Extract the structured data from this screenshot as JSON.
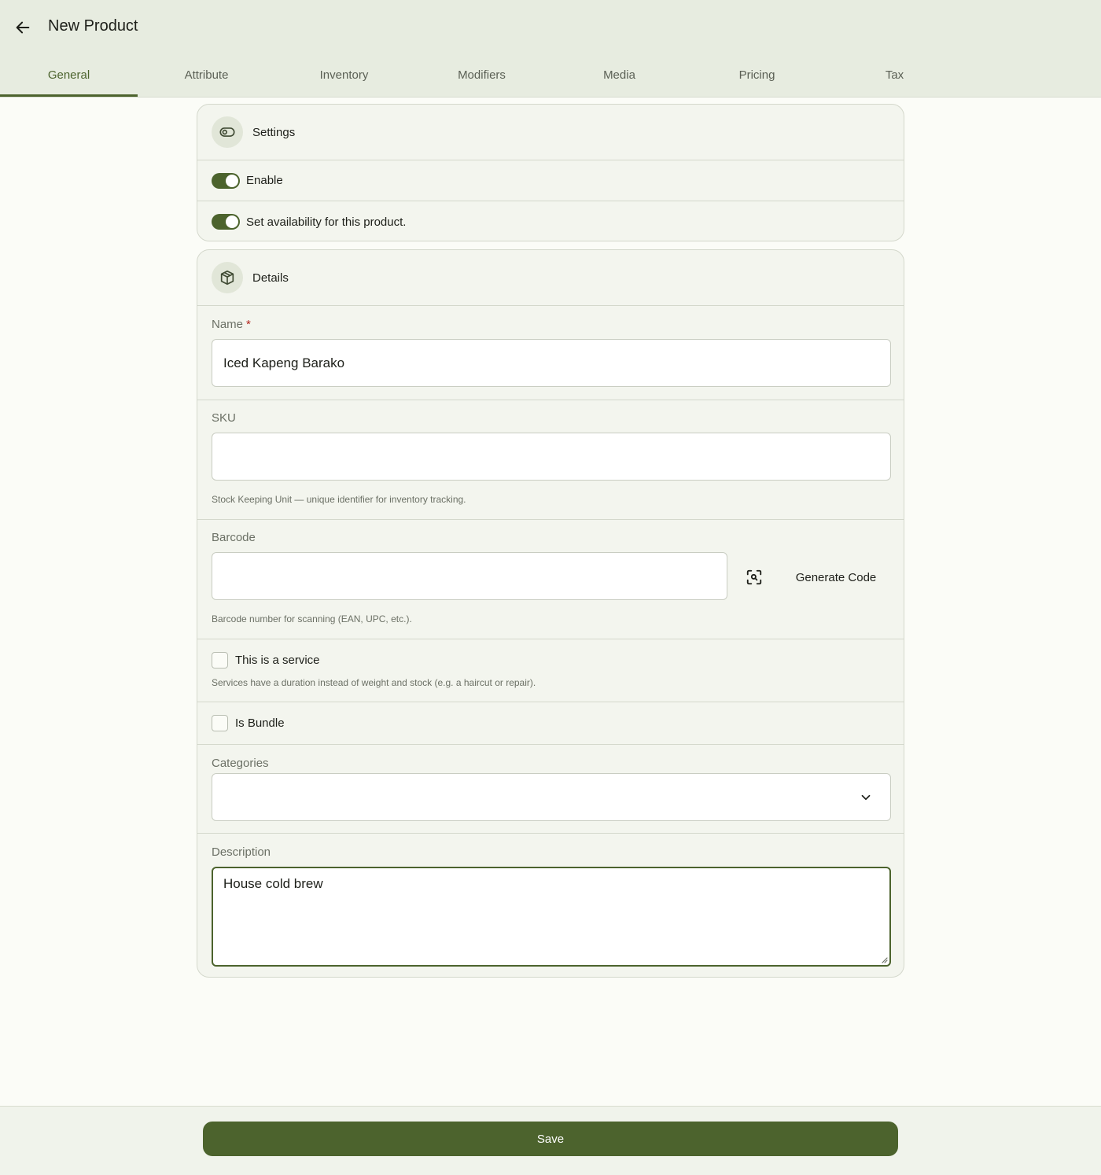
{
  "header": {
    "title": "New Product",
    "back_icon": "arrow-left-icon"
  },
  "tabs": [
    {
      "label": "General",
      "active": true
    },
    {
      "label": "Attribute",
      "active": false
    },
    {
      "label": "Inventory",
      "active": false
    },
    {
      "label": "Modifiers",
      "active": false
    },
    {
      "label": "Media",
      "active": false
    },
    {
      "label": "Pricing",
      "active": false
    },
    {
      "label": "Tax",
      "active": false
    }
  ],
  "settings": {
    "title": "Settings",
    "icon": "toggle-icon",
    "enable": {
      "label": "Enable",
      "on": true
    },
    "availability": {
      "label": "Set availability for this product.",
      "on": true
    }
  },
  "details": {
    "title": "Details",
    "icon": "box-icon",
    "name": {
      "label": "Name",
      "required_mark": "*",
      "value": "Iced Kapeng Barako"
    },
    "sku": {
      "label": "SKU",
      "value": "",
      "helper": "Stock Keeping Unit — unique identifier for inventory tracking."
    },
    "barcode": {
      "label": "Barcode",
      "value": "",
      "generate_label": "Generate Code",
      "helper": "Barcode number for scanning (EAN, UPC, etc.)."
    },
    "service": {
      "label": "This is a service",
      "checked": false,
      "helper": "Services have a duration instead of weight and stock (e.g. a haircut or repair)."
    },
    "bundle": {
      "label": "Is Bundle",
      "checked": false
    },
    "categories": {
      "label": "Categories",
      "value": ""
    },
    "description": {
      "label": "Description",
      "value": "House cold brew"
    }
  },
  "footer": {
    "save_label": "Save"
  },
  "colors": {
    "accent": "#4c632d",
    "header_bg": "#e7ece0",
    "page_bg": "#fbfcf7",
    "card_bg": "#f3f5ee",
    "required": "#b3261e"
  }
}
